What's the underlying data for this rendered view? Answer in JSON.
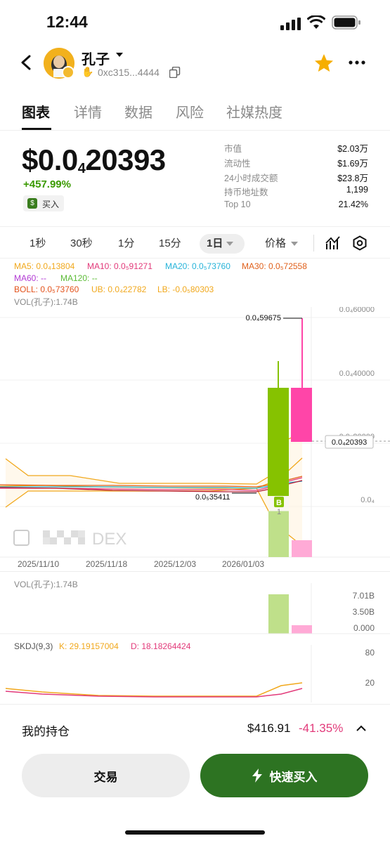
{
  "status": {
    "time": "12:44"
  },
  "header": {
    "token_name": "孔子",
    "address": "0xc315...4444"
  },
  "tabs": [
    "图表",
    "详情",
    "数据",
    "风险",
    "社媒热度"
  ],
  "price": {
    "prefix": "$0.0",
    "sub": "4",
    "digits": "20393",
    "change": "+457.99%",
    "buy_tag": "买入"
  },
  "stats": [
    {
      "label": "市值",
      "value": "$2.03万"
    },
    {
      "label": "流动性",
      "value": "$1.69万"
    },
    {
      "label": "24小时成交额",
      "value": "$23.8万"
    },
    {
      "label": "持币地址数",
      "value": "1,199"
    },
    {
      "label": "Top 10",
      "value": "21.42%"
    }
  ],
  "timeframes": [
    "1秒",
    "30秒",
    "1分",
    "15分",
    "1日"
  ],
  "selected_timeframe": "1日",
  "price_dropdown": "价格",
  "indicators": {
    "ma5": "MA5: 0.0₄13804",
    "ma10": "MA10: 0.0₅91271",
    "ma20": "MA20: 0.0₅73760",
    "ma30": "MA30: 0.0₅72558",
    "ma60": "MA60: --",
    "ma120": "MA120: --",
    "boll": "BOLL: 0.0₅73760",
    "ub": "UB: 0.0₄22782",
    "lb": "LB: -0.0₅80303",
    "vol": "VOL(孔子):1.74B"
  },
  "chart": {
    "y_ticks": [
      "0.0₄60000",
      "0.0₄40000",
      "0.0₄20000",
      "0.0₄"
    ],
    "x_ticks": [
      "2025/11/10",
      "2025/11/18",
      "2025/12/03",
      "2026/01/03"
    ],
    "high_label": "0.0₄59675",
    "low_label": "0.0₅35411",
    "current_label": "0.0₄20393",
    "buy_marker": "B",
    "buy_count": "1",
    "watermark": "DEX",
    "colors": {
      "up": "#86c200",
      "down": "#ff45a8"
    }
  },
  "volume_panel": {
    "title": "VOL(孔子):1.74B",
    "ticks": [
      "7.01B",
      "3.50B",
      "0.000"
    ]
  },
  "skdj_panel": {
    "title": "SKDJ(9,3)",
    "k": "K: 29.19157004",
    "d": "D: 18.18264424",
    "ticks": [
      "80",
      "20"
    ]
  },
  "holdings": {
    "label": "我的持仓",
    "value": "$416.91",
    "change": "-41.35%"
  },
  "buttons": {
    "trade": "交易",
    "quick_buy": "快速买入"
  }
}
